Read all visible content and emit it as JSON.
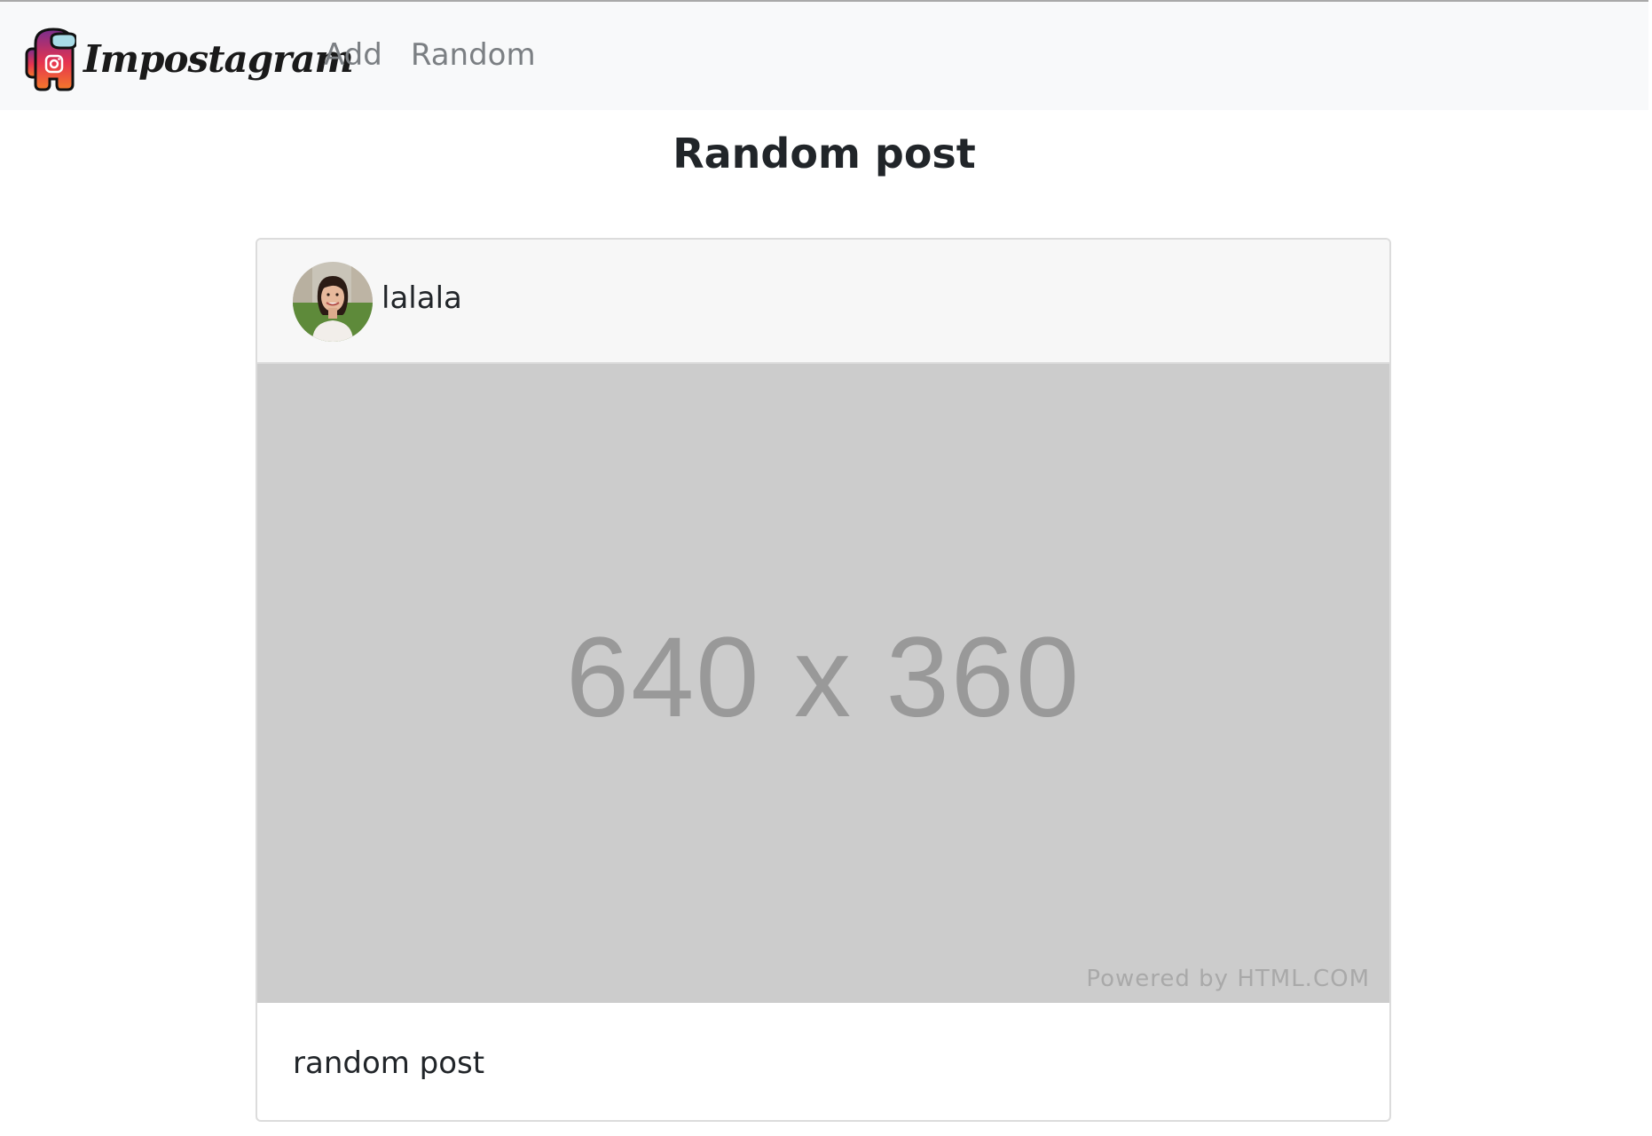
{
  "navbar": {
    "brand": "Impostagram",
    "links": [
      {
        "label": "Add"
      },
      {
        "label": "Random"
      }
    ]
  },
  "page_title": "Random post",
  "post": {
    "username": "lalala",
    "image_placeholder": "640 x 360",
    "image_credit": "Powered by HTML.COM",
    "caption": "random post"
  },
  "colors": {
    "navbar_bg": "#f8f9fa",
    "nav_link": "#7b7f83",
    "placeholder_bg": "#cccccc",
    "logo_red": "#e6334f",
    "logo_pink": "#c2327e"
  }
}
